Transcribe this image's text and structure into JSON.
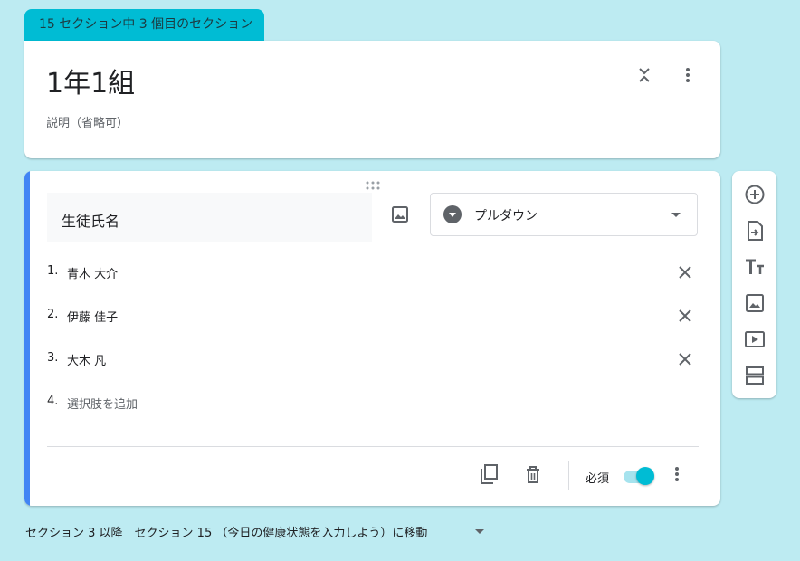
{
  "section_tab": {
    "label": "15 セクション中 3 個目のセクション"
  },
  "header": {
    "title": "1年1組",
    "description": "説明（省略可）",
    "collapse_icon": "collapse-icon",
    "more_icon": "more-vert-icon"
  },
  "question": {
    "title": "生徒氏名",
    "type_label": "プルダウン",
    "options": [
      {
        "number": "1.",
        "text": "青木 大介"
      },
      {
        "number": "2.",
        "text": "伊藤 佳子"
      },
      {
        "number": "3.",
        "text": "大木 凡"
      }
    ],
    "add_option": {
      "number": "4.",
      "text": "選択肢を追加"
    },
    "required_label": "必須",
    "required": true
  },
  "side_toolbar": {
    "icons": [
      "add-circle-icon",
      "import-icon",
      "title-icon",
      "image-icon",
      "video-icon",
      "section-icon"
    ]
  },
  "section_nav": {
    "text": "セクション 3 以降　セクション 15 （今日の健康状態を入力しよう）に移動"
  },
  "colors": {
    "background": "#bdebf2",
    "accent": "#00bcd4",
    "question_accent": "#4285f4"
  }
}
